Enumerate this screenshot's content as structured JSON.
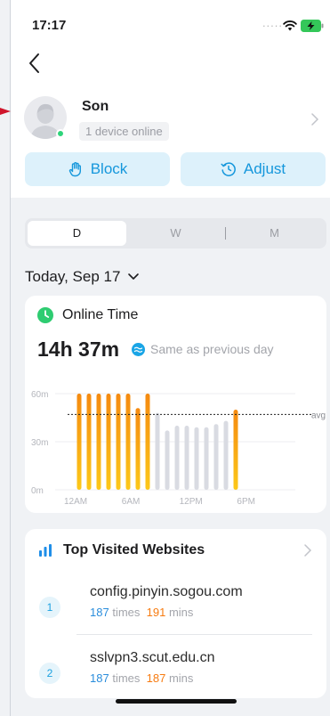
{
  "status_bar": {
    "time": "17:17",
    "signal_dots": "....."
  },
  "profile": {
    "name": "Son",
    "device_status": "1 device online"
  },
  "actions": {
    "block_label": "Block",
    "adjust_label": "Adjust"
  },
  "period_tabs": [
    {
      "label": "D",
      "selected": true
    },
    {
      "label": "W",
      "selected": false
    },
    {
      "label": "M",
      "selected": false
    }
  ],
  "date_label": "Today, Sep 17",
  "online_time": {
    "title": "Online Time",
    "total": "14h 37m",
    "comparison": "Same as previous day"
  },
  "chart_data": {
    "type": "bar",
    "y_ticks": [
      "60m",
      "30m",
      "0m"
    ],
    "ylim": [
      0,
      60
    ],
    "x_ticks": [
      "12AM",
      "6AM",
      "12PM",
      "6PM"
    ],
    "avg_label": "avg",
    "avg_value": 47,
    "hours": [
      0,
      1,
      2,
      3,
      4,
      5,
      6,
      7,
      8,
      9,
      10,
      11,
      12,
      13,
      14,
      15,
      16,
      17
    ],
    "values": [
      60,
      60,
      60,
      60,
      60,
      60,
      51,
      60,
      48,
      37,
      40,
      40,
      39,
      39,
      41,
      43,
      50,
      0
    ],
    "highlighted": [
      true,
      true,
      true,
      true,
      true,
      true,
      true,
      true,
      false,
      false,
      false,
      false,
      false,
      false,
      false,
      false,
      true,
      false
    ],
    "colors": {
      "highlight_top": "#f58a10",
      "highlight_bottom": "#fcc819",
      "muted": "#d9dbe2"
    }
  },
  "top_websites": {
    "title": "Top Visited Websites",
    "items": [
      {
        "rank": "1",
        "domain": "config.pinyin.sogou.com",
        "times": "187",
        "times_unit": "times",
        "mins": "191",
        "mins_unit": "mins"
      },
      {
        "rank": "2",
        "domain": "sslvpn3.scut.edu.cn",
        "times": "187",
        "times_unit": "times",
        "mins": "187",
        "mins_unit": "mins"
      }
    ]
  }
}
